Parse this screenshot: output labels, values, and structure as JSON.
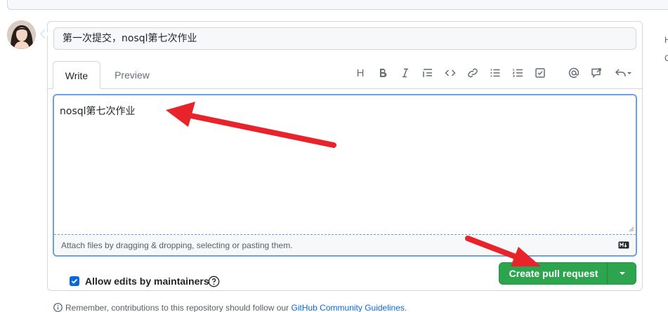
{
  "pr": {
    "title_value": "第一次提交，nosql第七次作业",
    "body_value": "nosql第七次作业"
  },
  "tabs": [
    {
      "label": "Write"
    },
    {
      "label": "Preview"
    }
  ],
  "toolbar": {
    "heading_glyph": "H",
    "icons": [
      "heading-icon",
      "bold-icon",
      "italic-icon",
      "quote-icon",
      "code-icon",
      "link-icon",
      "unordered-list-icon",
      "ordered-list-icon",
      "task-list-icon",
      "mention-icon",
      "reference-icon",
      "reply-icon"
    ]
  },
  "attach": {
    "text": "Attach files by dragging & dropping, selecting or pasting them."
  },
  "options": {
    "allow_edits_label": "Allow edits by maintainers",
    "allow_edits_checked": true
  },
  "actions": {
    "create_label": "Create pull request"
  },
  "footer": {
    "prefix": "Remember, contributions to this repository should follow our ",
    "link": "GitHub Community Guidelines",
    "suffix": "."
  },
  "sidebar_edge": {
    "letter_1": "H",
    "letter_2": "C"
  },
  "colors": {
    "accent": "#0969da",
    "primary_button": "#2da44e",
    "annotation_arrow": "#e8242a"
  }
}
